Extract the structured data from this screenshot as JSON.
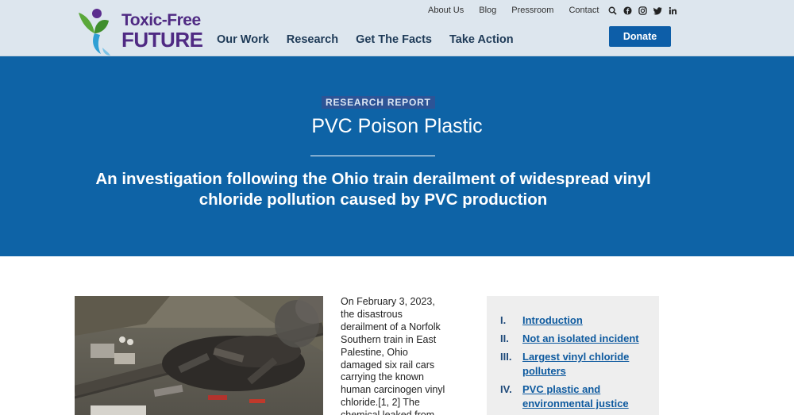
{
  "logo": {
    "line1": "Toxic-Free",
    "line2": "FUTURE"
  },
  "utility_nav": {
    "links": [
      "About Us",
      "Blog",
      "Pressroom",
      "Contact"
    ],
    "icons": [
      "search-icon",
      "facebook-icon",
      "instagram-icon",
      "twitter-icon",
      "linkedin-icon"
    ]
  },
  "main_nav": {
    "items": [
      "Our Work",
      "Research",
      "Get The Facts",
      "Take Action"
    ]
  },
  "donate_label": "Donate",
  "hero": {
    "eyebrow": "RESEARCH REPORT",
    "title": "PVC Poison Plastic",
    "subtitle": "An investigation following the Ohio train derailment of widespread vinyl chloride pollution caused by PVC production"
  },
  "article": {
    "intro": "On February 3, 2023, the disastrous derailment of a Norfolk Southern train in East Palestine, Ohio damaged six rail cars carrying the known human carcinogen vinyl chloride.[1, 2] The chemical leaked from"
  },
  "toc": {
    "items": [
      {
        "num": "I.",
        "label": "Introduction"
      },
      {
        "num": "II.",
        "label": "Not an isolated incident"
      },
      {
        "num": "III.",
        "label": "Largest vinyl chloride polluters"
      },
      {
        "num": "IV.",
        "label": "PVC plastic and environmental justice"
      }
    ]
  },
  "colors": {
    "header_bg": "#dde6ee",
    "hero_bg": "#0e63a6",
    "brand_purple": "#4f2a83",
    "donate_bg": "#0d5ea8",
    "toc_bg": "#eeeeee"
  }
}
